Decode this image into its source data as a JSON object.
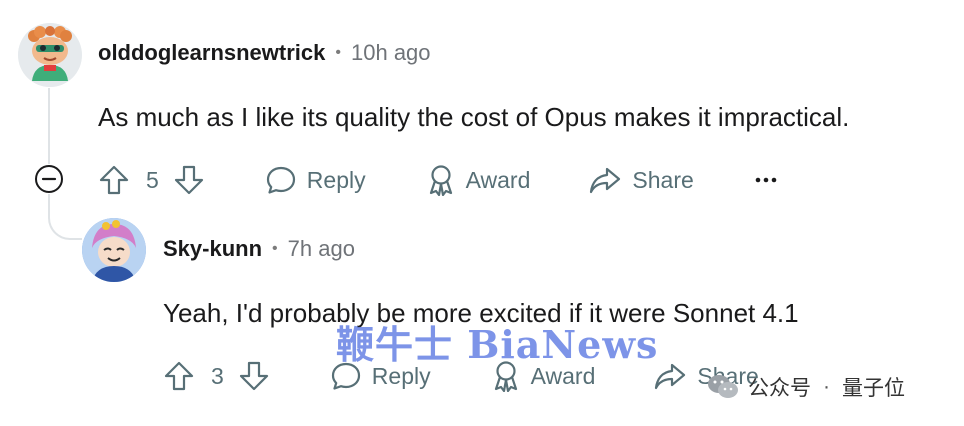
{
  "comments": [
    {
      "username": "olddoglearnsnewtrick",
      "separator": "•",
      "time": "10h ago",
      "body": "As much as I like its quality the cost of Opus makes it impractical.",
      "votes": "5",
      "actions": {
        "reply": "Reply",
        "award": "Award",
        "share": "Share",
        "more": "•••"
      }
    },
    {
      "username": "Sky-kunn",
      "separator": "•",
      "time": "7h ago",
      "body": "Yeah, I'd probably be more excited if it were Sonnet 4.1",
      "votes": "3",
      "actions": {
        "reply": "Reply",
        "award": "Award",
        "share": "Share",
        "more": "•••"
      }
    }
  ],
  "watermark": {
    "main": "鞭牛士 BiaNews",
    "platform": "公众号",
    "separator": "·",
    "account": "量子位"
  },
  "colors": {
    "text": "#1a1a1b",
    "muted": "#576f76",
    "thread": "#dfe3e6",
    "watermark": "#5876e2"
  }
}
